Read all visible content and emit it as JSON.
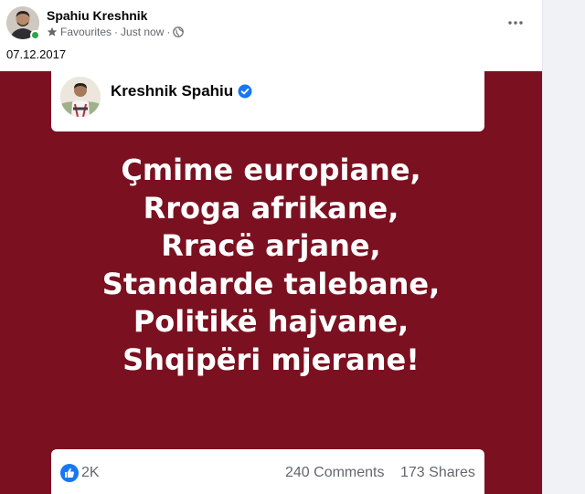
{
  "post": {
    "author": "Spahiu Kreshnik",
    "audience": "Favourites",
    "separator": "·",
    "time": "Just now",
    "separator2": "·",
    "text": "07.12.2017"
  },
  "embedded": {
    "author": "Kreshnik Spahiu",
    "verified_color": "#1877f2",
    "background_color": "#7b1120",
    "lines": [
      "Çmime europiane,",
      "Rroga afrikane,",
      "Rracë arjane,",
      "Standarde talebane,",
      "Politikë hajvane,",
      "Shqipëri mjerane!"
    ],
    "likes": "2K",
    "comments": "240 Comments",
    "shares": "173 Shares"
  },
  "icons": {
    "audience_icon": "star-icon",
    "privacy_icon": "globe-icon",
    "more_icon": "more-dots-icon",
    "like_icon": "like-thumb-icon",
    "verified_icon": "verified-badge-icon"
  },
  "colors": {
    "online": "#31a24c",
    "meta_text": "#65676b",
    "like_blue": "#1877f2"
  }
}
